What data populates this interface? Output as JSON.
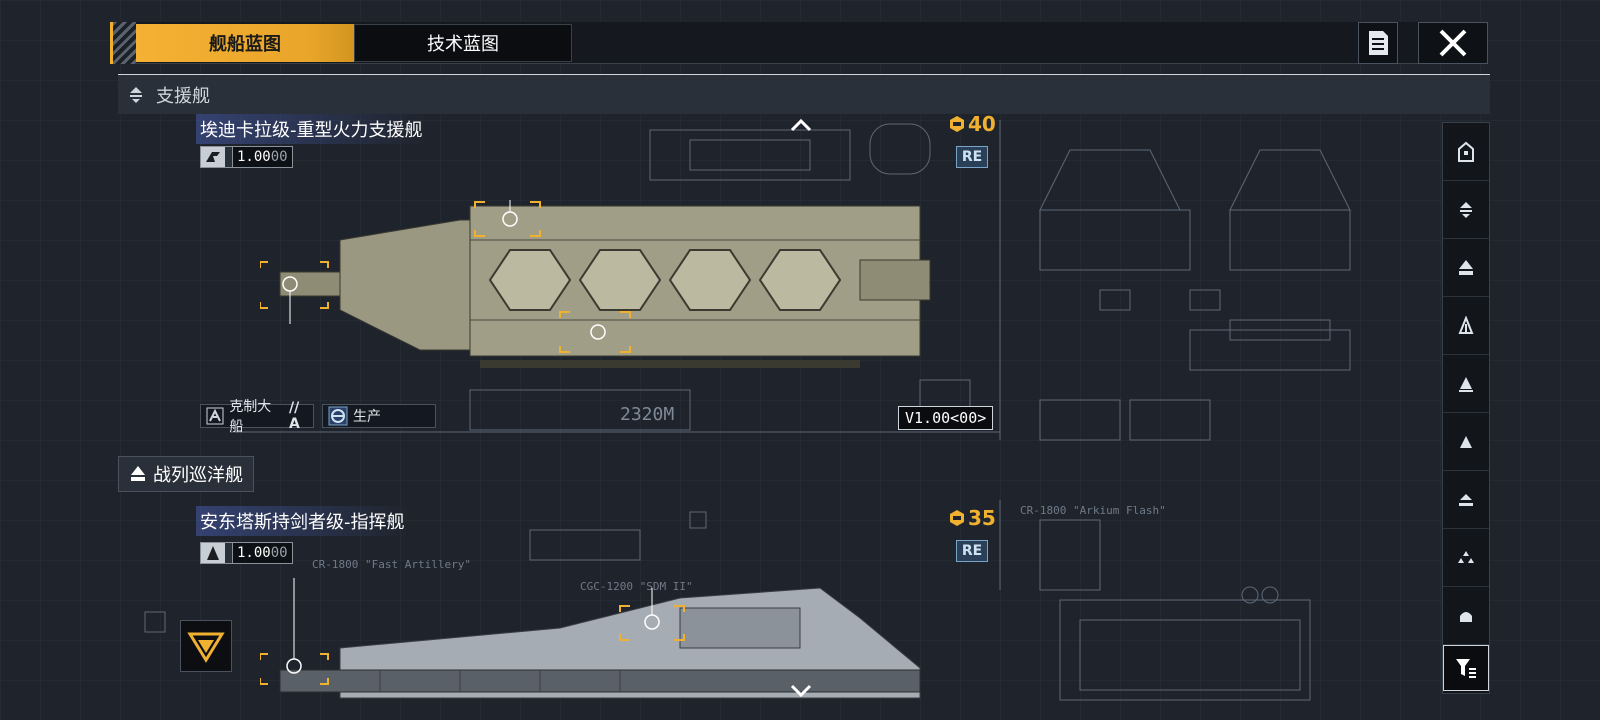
{
  "tabs": {
    "ship_blueprint": "舰船蓝图",
    "tech_blueprint": "技术蓝图"
  },
  "sections": {
    "support": {
      "label": "支援舰",
      "icon": "support-ship-class-icon"
    },
    "battlecruiser": {
      "label": "战列巡洋舰",
      "icon": "battlecruiser-class-icon"
    }
  },
  "ships": [
    {
      "name": "埃迪卡拉级-重型火力支援舰",
      "version": "1",
      "version_value": "1.00",
      "version_suffix": "00",
      "cost": "40",
      "badge": "RE",
      "traits": [
        {
          "label": "克制大船",
          "suffix": "// A",
          "icon": "counter-large-ship-icon"
        },
        {
          "label": "生产",
          "icon": "production-icon"
        }
      ],
      "length_label": "2320M",
      "blueprint_version": "V1.00<00>"
    },
    {
      "name": "安东塔斯持剑者级-指挥舰",
      "version": "1",
      "version_value": "1.00",
      "version_suffix": "00",
      "cost": "35",
      "badge": "RE",
      "label_a": "CR-1800 \"Fast Artillery\"",
      "label_b": "CGC-1200 \"SDM II\""
    }
  ],
  "blueprint_labels": {
    "label_1": "CR-1800 \"Arkium Flash\""
  },
  "rail_items": [
    "carrier-class-icon",
    "support-ship-class-icon",
    "battlecruiser-class-icon",
    "cruiser-class-icon",
    "destroyer-class-icon",
    "frigate-class-icon",
    "corvette-class-icon",
    "fighter-class-icon",
    "auxiliary-class-icon",
    "filter-icon"
  ],
  "colors": {
    "accent": "#f0b030",
    "background": "#1f242c",
    "badge": "#2a4058"
  }
}
